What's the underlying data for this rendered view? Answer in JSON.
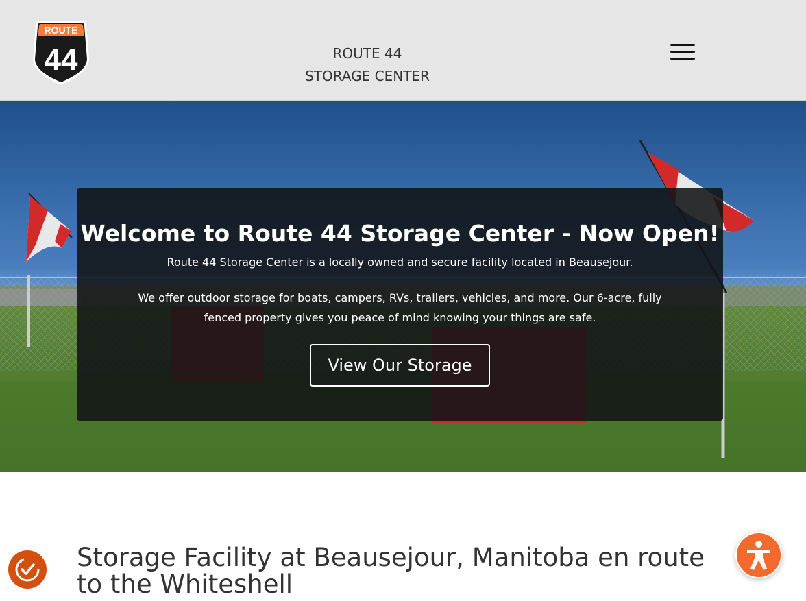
{
  "header": {
    "logo": {
      "top_text": "ROUTE",
      "number": "44"
    },
    "title_line1": "ROUTE 44",
    "title_line2": "STORAGE CENTER",
    "menu_icon": "hamburger-icon"
  },
  "hero": {
    "title": "Welcome to Route 44 Storage Center - Now Open!",
    "subtitle": "Route 44 Storage Center is a locally owned and secure facility located in Beausejour.",
    "description": "We offer outdoor storage for boats, campers, RVs, trailers, vehicles, and more. Our 6-acre, fully fenced property gives you peace of mind knowing your things are safe.",
    "button_label": "View Our Storage"
  },
  "section": {
    "title": "Storage Facility at Beausejour, Manitoba en route to the Whiteshell"
  },
  "widgets": {
    "left_badge_icon": "checklist-clock-icon",
    "accessibility_icon": "accessibility-person-icon"
  },
  "colors": {
    "header_bg": "#e6e6e6",
    "accent_orange": "#f26a2e",
    "logo_orange": "#f47b3b",
    "hero_overlay": "#111316"
  }
}
